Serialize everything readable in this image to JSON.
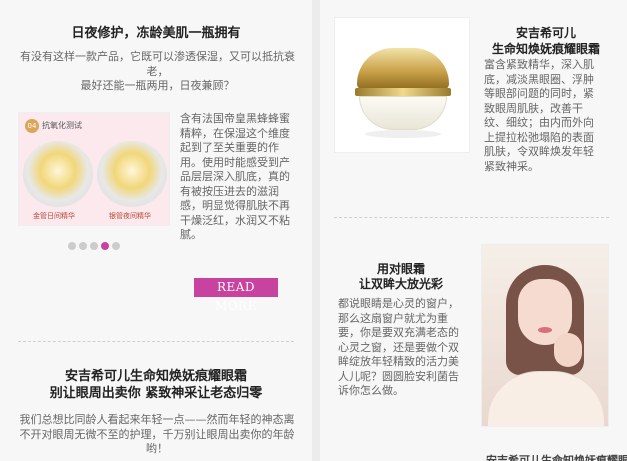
{
  "left_card": {
    "title": "日夜修护，冻龄美肌一瓶拥有",
    "intro": "有没有这样一款产品，它既可以渗透保湿，又可以抵抗衰老，\n最好还能一瓶两用，日夜兼顾？",
    "photo": {
      "tag_number": "04",
      "tag_label": "抗氧化测试",
      "caption_left": "金管日间精华",
      "caption_right": "银管夜间精华"
    },
    "side_text": "含有法国帝皇黑蜂蜂蜜精粹，在保湿这个维度起到了至关重要的作用。使用时能感受到产品层层深入肌底，真的有被按压进去的滋润感，明显觉得肌肤不再干燥泛红，水润又不粘腻。",
    "dots": 5,
    "active_dot": 3,
    "read_more_label": "READ MORE"
  },
  "left_card_2": {
    "title_line1": "安吉希可儿生命知焕妩痕耀眼霜",
    "title_line2": "别让眼周出卖你 紧致神采让老态归零",
    "text": "我们总想比同龄人看起来年轻一点——然而年轻的神态离不开对眼周无微不至的护理，千万别让眼周出卖你的年龄哟！"
  },
  "right_card_1": {
    "title_line1": "安吉希可儿",
    "title_line2": "生命知焕妩痕耀眼霜",
    "text": "富含紧致精华，深入肌底，减淡黑眼圈、浮肿等眼部问题的同时，紧致眼周肌肤，改善干纹、细纹；由内而外向上提拉松弛塌陷的表面肌肤，令双眸焕发年轻紧致神采。"
  },
  "right_card_2": {
    "title_line1": "用对眼霜",
    "title_line2": "让双眸大放光彩",
    "text": "都说眼睛是心灵的窗户，那么这扇窗户就尤为重要，你是要双充满老态的心灵之窗，还是要做个双眸绽放年轻精致的活力美人儿呢？圆圆脸安利菌告诉你怎么做。"
  },
  "right_cut_text": "安吉希可儿生命知焕妩痕耀眼霜",
  "colors": {
    "accent": "#c7439f",
    "background": "#ececec",
    "card": "#f7f7f7"
  }
}
